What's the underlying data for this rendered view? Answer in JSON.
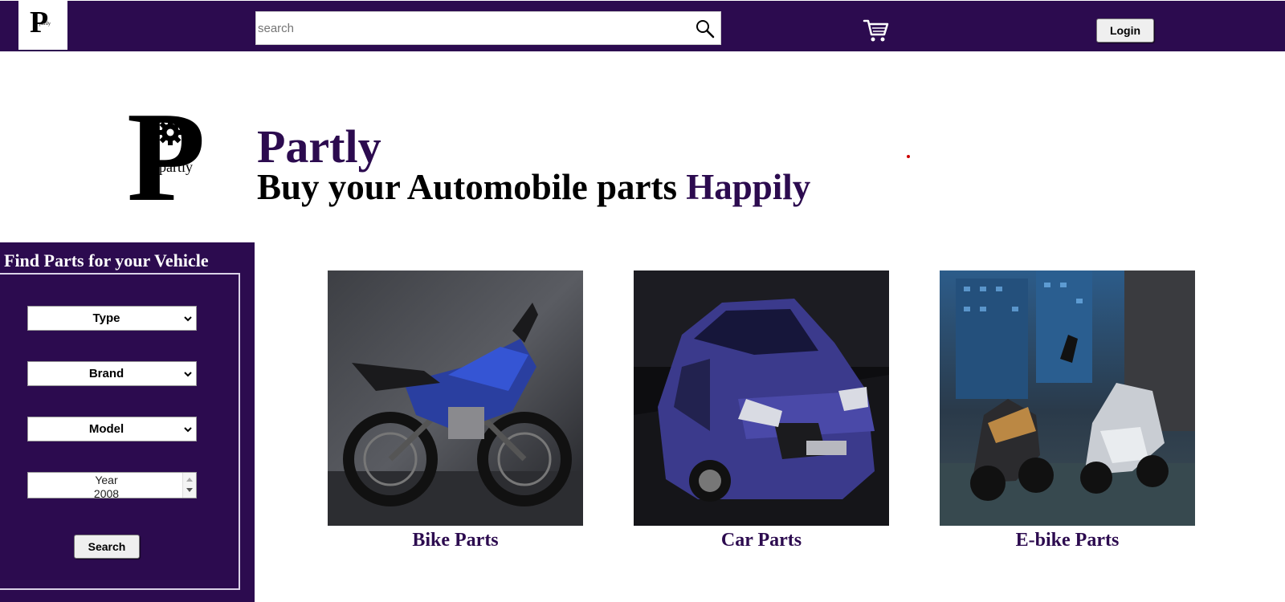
{
  "nav": {
    "logo_letter": "P",
    "logo_small": "partly",
    "search_placeholder": "search",
    "cart_icon": "cart-icon",
    "login_label": "Login"
  },
  "hero": {
    "logo_letter": "P",
    "logo_small": "partly",
    "title": "Partly",
    "tagline_main": "Buy your Automobile parts ",
    "tagline_accent": "Happily"
  },
  "finder": {
    "title": "Find Parts for your Vehicle",
    "type_label": "Type",
    "brand_label": "Brand",
    "model_label": "Model",
    "year_label": "Year",
    "year_value": "2008",
    "search_label": "Search"
  },
  "categories": [
    {
      "label": "Bike Parts",
      "image": "motorcycle"
    },
    {
      "label": "Car Parts",
      "image": "car"
    },
    {
      "label": "E-bike Parts",
      "image": "electric-scooters"
    }
  ],
  "colors": {
    "brand": "#2c0b4f",
    "background": "#ffffff"
  }
}
